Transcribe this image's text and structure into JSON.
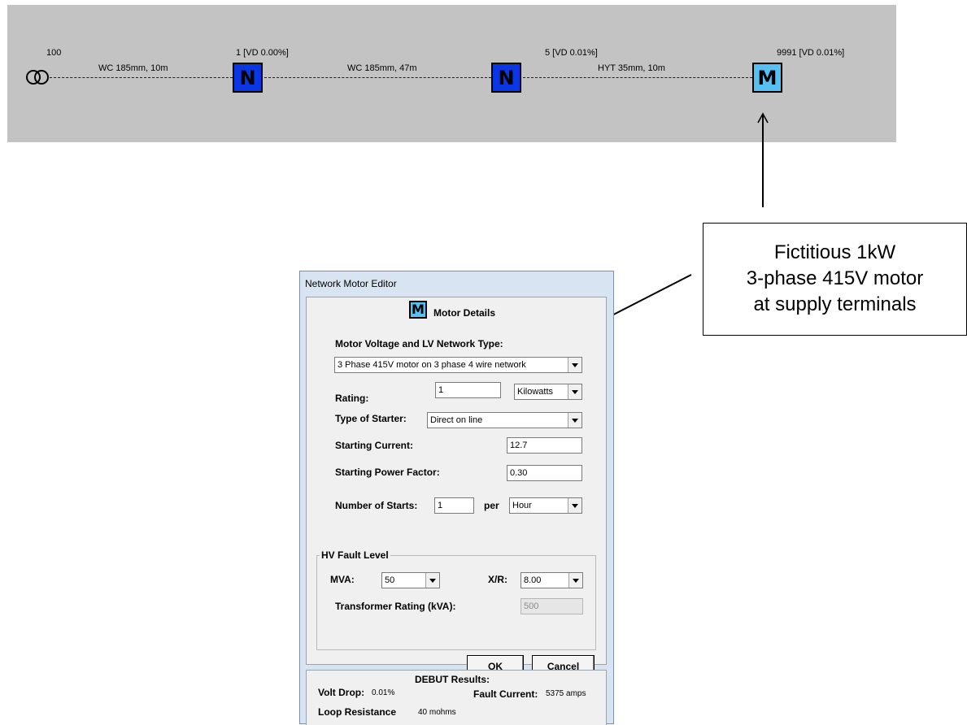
{
  "network": {
    "source_label": "100",
    "cable_1": "WC 185mm, 10m",
    "node_1_label": "1 [VD 0.00%]",
    "node_1_symbol": "N",
    "cable_2": "WC 185mm, 47m",
    "node_2_label": "5 [VD 0.01%]",
    "node_2_symbol": "N",
    "cable_3": "HYT 35mm, 10m",
    "motor_label": "9991 [VD 0.01%]",
    "motor_symbol": "M",
    "colors": {
      "background": "#c3c3c3",
      "node": "#0a37e6",
      "motor": "#56c0f2"
    }
  },
  "annotation": {
    "lines": [
      "Fictitious 1kW",
      "3-phase 415V motor",
      "at supply terminals"
    ]
  },
  "dialog": {
    "title": "Network Motor Editor",
    "header_icon": "M",
    "header": "Motor Details",
    "voltage_type_label": "Motor Voltage and LV Network Type:",
    "voltage_type_value": "3 Phase 415V motor on 3 phase 4 wire network",
    "rating_label": "Rating:",
    "rating_value": "1",
    "rating_unit": "Kilowatts",
    "starter_label": "Type of Starter:",
    "starter_value": "Direct on line",
    "starting_current_label": "Starting Current:",
    "starting_current_value": "12.7",
    "starting_pf_label": "Starting Power Factor:",
    "starting_pf_value": "0.30",
    "starts_label": "Number of Starts:",
    "starts_value": "1",
    "per_label": "per",
    "per_value": "Hour",
    "hv_group": "HV Fault Level",
    "mva_label": "MVA:",
    "mva_value": "50",
    "xr_label": "X/R:",
    "xr_value": "8.00",
    "tx_rating_label": "Transformer Rating (kVA):",
    "tx_rating_value": "500",
    "ok_label": "OK",
    "ok_mnemonic": "O",
    "ok_rest": "K",
    "cancel_mnemonic": "C",
    "cancel_rest": "ancel",
    "results_title": "DEBUT Results:",
    "volt_drop_label": "Volt Drop:",
    "volt_drop_value": "0.01%",
    "fault_current_label": "Fault Current:",
    "fault_current_value": "5375 amps",
    "loop_resistance_label": "Loop Resistance",
    "loop_resistance_value": "40 mohms"
  }
}
